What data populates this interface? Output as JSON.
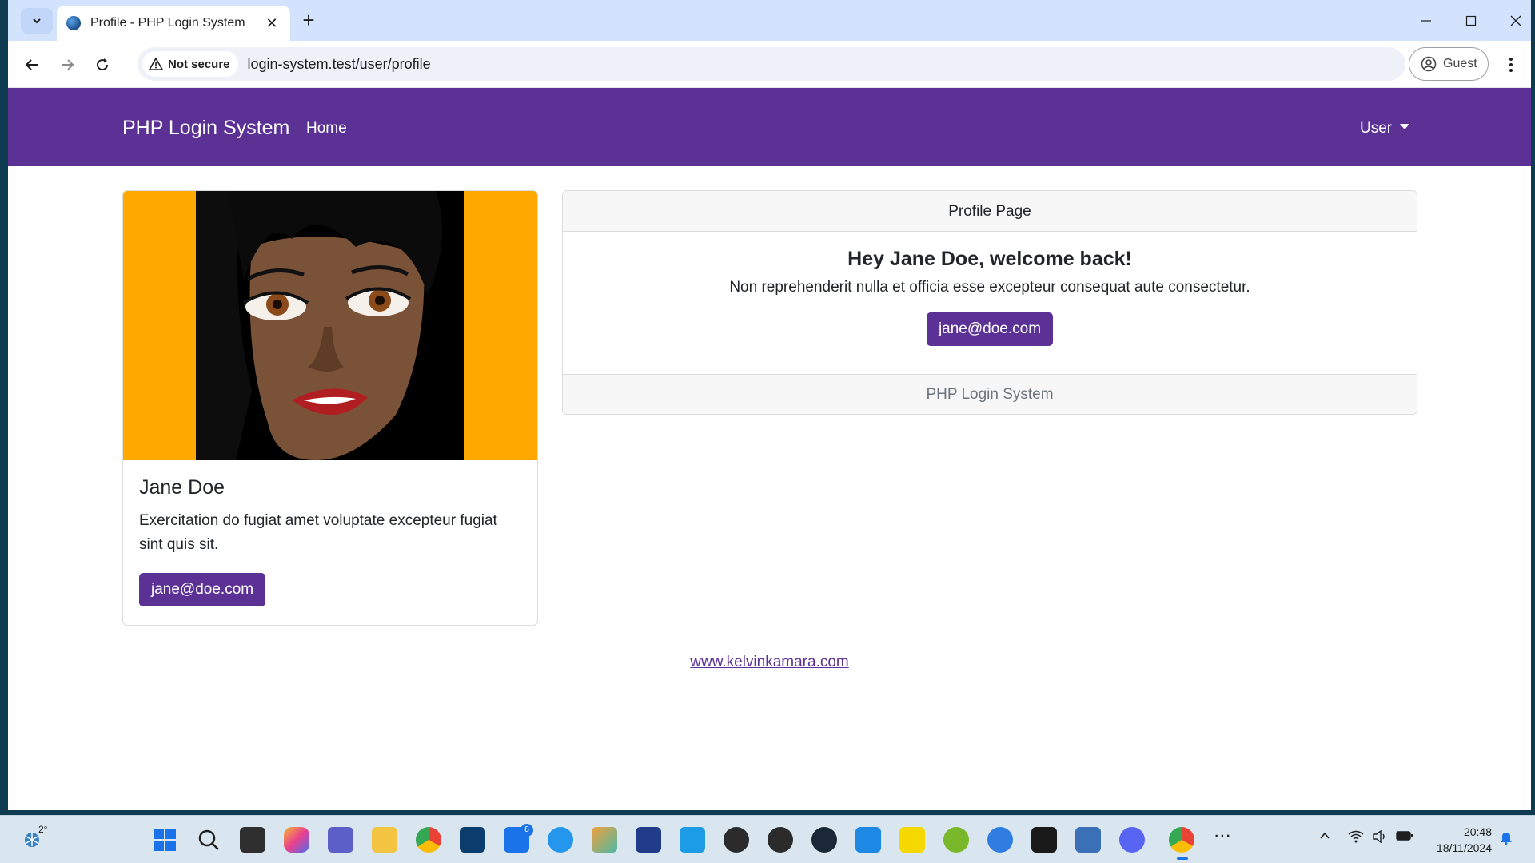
{
  "browser": {
    "tab_title": "Profile - PHP Login System",
    "security_label": "Not secure",
    "url": "login-system.test/user/profile",
    "profile_label": "Guest"
  },
  "nav": {
    "brand": "PHP Login System",
    "home": "Home",
    "user": "User"
  },
  "profile_card": {
    "name": "Jane Doe",
    "bio": "Exercitation do fugiat amet voluptate excepteur fugiat sint quis sit.",
    "email_button": "jane@doe.com"
  },
  "main_card": {
    "header": "Profile Page",
    "welcome": "Hey Jane Doe, welcome back!",
    "lead": "Non reprehenderit nulla et officia esse excepteur consequat aute consectetur.",
    "email_button": "jane@doe.com",
    "footer": "PHP Login System"
  },
  "footer": {
    "link": "www.kelvinkamara.com"
  },
  "taskbar": {
    "weather": "2°",
    "time": "20:48",
    "date": "18/11/2024",
    "badge_todo": "8"
  },
  "colors": {
    "brand_purple": "#5b3196",
    "card_image_bg": "#ffa800",
    "tabbar_bg": "#d3e3fd"
  }
}
